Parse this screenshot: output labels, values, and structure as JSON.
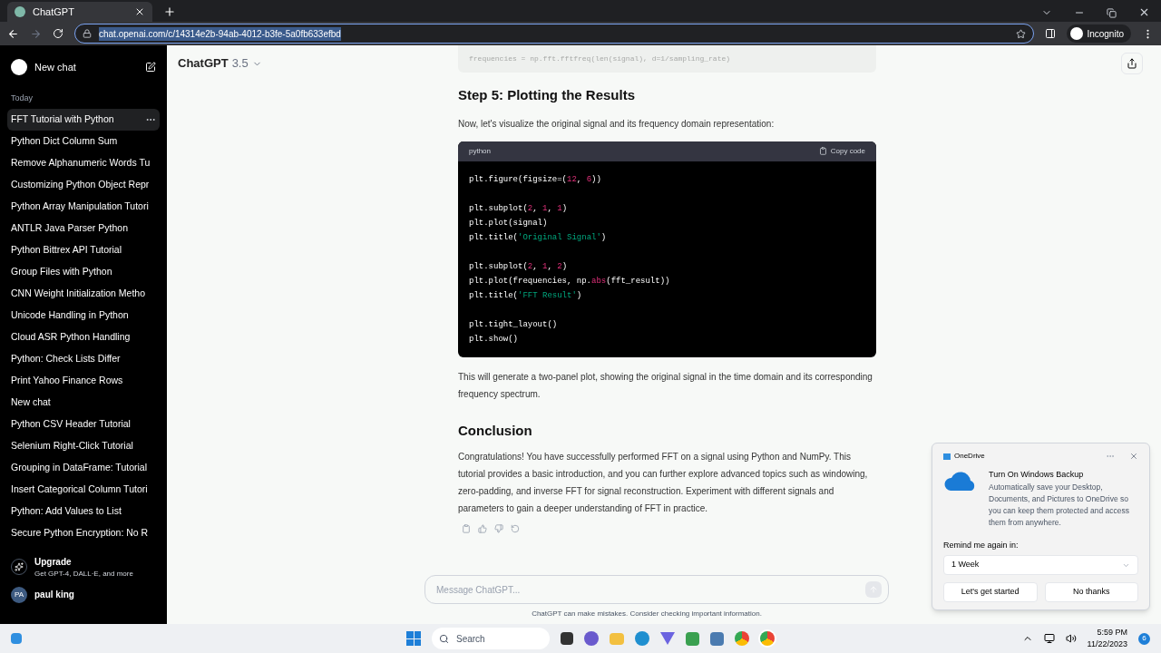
{
  "browser": {
    "tab_title": "ChatGPT",
    "url": "chat.openai.com/c/14314e2b-94ab-4012-b3fe-5a0fb633efbd",
    "profile": "Incognito"
  },
  "sidebar": {
    "new_chat": "New chat",
    "section": "Today",
    "items": [
      {
        "label": "FFT Tutorial with Python",
        "selected": true
      },
      {
        "label": "Python Dict Column Sum",
        "selected": false
      },
      {
        "label": "Remove Alphanumeric Words Tu",
        "selected": false
      },
      {
        "label": "Customizing Python Object Repr",
        "selected": false
      },
      {
        "label": "Python Array Manipulation Tutori",
        "selected": false
      },
      {
        "label": "ANTLR Java Parser Python",
        "selected": false
      },
      {
        "label": "Python Bittrex API Tutorial",
        "selected": false
      },
      {
        "label": "Group Files with Python",
        "selected": false
      },
      {
        "label": "CNN Weight Initialization Metho",
        "selected": false
      },
      {
        "label": "Unicode Handling in Python",
        "selected": false
      },
      {
        "label": "Cloud ASR Python Handling",
        "selected": false
      },
      {
        "label": "Python: Check Lists Differ",
        "selected": false
      },
      {
        "label": "Print Yahoo Finance Rows",
        "selected": false
      },
      {
        "label": "New chat",
        "selected": false
      },
      {
        "label": "Python CSV Header Tutorial",
        "selected": false
      },
      {
        "label": "Selenium Right-Click Tutorial",
        "selected": false
      },
      {
        "label": "Grouping in DataFrame: Tutorial",
        "selected": false
      },
      {
        "label": "Insert Categorical Column Tutori",
        "selected": false
      },
      {
        "label": "Python: Add Values to List",
        "selected": false
      },
      {
        "label": "Secure Python Encryption: No R",
        "selected": false
      }
    ],
    "upgrade": {
      "title": "Upgrade",
      "subtitle": "Get GPT-4, DALL·E, and more"
    },
    "user": {
      "initials": "PA",
      "name": "paul king"
    }
  },
  "header": {
    "model": "ChatGPT",
    "version": "3.5"
  },
  "content": {
    "faded_code": "frequencies = np.fft.fftfreq(len(signal), d=1/sampling_rate)",
    "heading_1": "Step 5: Plotting the Results",
    "intro": "Now, let's visualize the original signal and its frequency domain representation:",
    "code_block": {
      "language": "python",
      "copy_label": "Copy code",
      "lines": [
        {
          "gap_after": true,
          "segments": [
            {
              "t": "plt.figure(figsize=(",
              "kind": "plain"
            },
            {
              "t": "12",
              "kind": "number"
            },
            {
              "t": ", ",
              "kind": "plain"
            },
            {
              "t": "6",
              "kind": "number"
            },
            {
              "t": "))",
              "kind": "plain"
            }
          ]
        },
        {
          "gap_after": false,
          "segments": [
            {
              "t": "plt.subplot(",
              "kind": "plain"
            },
            {
              "t": "2",
              "kind": "number"
            },
            {
              "t": ", ",
              "kind": "plain"
            },
            {
              "t": "1",
              "kind": "number"
            },
            {
              "t": ", ",
              "kind": "plain"
            },
            {
              "t": "1",
              "kind": "number"
            },
            {
              "t": ")",
              "kind": "plain"
            }
          ]
        },
        {
          "gap_after": false,
          "segments": [
            {
              "t": "plt.plot(signal)",
              "kind": "plain"
            }
          ]
        },
        {
          "gap_after": true,
          "segments": [
            {
              "t": "plt.title(",
              "kind": "plain"
            },
            {
              "t": "'Original Signal'",
              "kind": "string"
            },
            {
              "t": ")",
              "kind": "plain"
            }
          ]
        },
        {
          "gap_after": false,
          "segments": [
            {
              "t": "plt.subplot(",
              "kind": "plain"
            },
            {
              "t": "2",
              "kind": "number"
            },
            {
              "t": ", ",
              "kind": "plain"
            },
            {
              "t": "1",
              "kind": "number"
            },
            {
              "t": ", ",
              "kind": "plain"
            },
            {
              "t": "2",
              "kind": "number"
            },
            {
              "t": ")",
              "kind": "plain"
            }
          ]
        },
        {
          "gap_after": false,
          "segments": [
            {
              "t": "plt.plot(frequencies, np.",
              "kind": "plain"
            },
            {
              "t": "abs",
              "kind": "builtin"
            },
            {
              "t": "(fft_result))",
              "kind": "plain"
            }
          ]
        },
        {
          "gap_after": true,
          "segments": [
            {
              "t": "plt.title(",
              "kind": "plain"
            },
            {
              "t": "'FFT Result'",
              "kind": "string"
            },
            {
              "t": ")",
              "kind": "plain"
            }
          ]
        },
        {
          "gap_after": false,
          "segments": [
            {
              "t": "plt.tight_layout()",
              "kind": "plain"
            }
          ]
        },
        {
          "gap_after": false,
          "segments": [
            {
              "t": "plt.show()",
              "kind": "plain"
            }
          ]
        }
      ]
    },
    "paragraph_2": "This will generate a two-panel plot, showing the original signal in the time domain and its corresponding frequency spectrum.",
    "heading_2": "Conclusion",
    "paragraph_3": "Congratulations! You have successfully performed FFT on a signal using Python and NumPy. This tutorial provides a basic introduction, and you can further explore advanced topics such as windowing, zero-padding, and inverse FFT for signal reconstruction. Experiment with different signals and parameters to gain a deeper understanding of FFT in practice."
  },
  "composer": {
    "placeholder": "Message ChatGPT...",
    "disclaimer": "ChatGPT can make mistakes. Consider checking important information."
  },
  "notification": {
    "app": "OneDrive",
    "title": "Turn On Windows Backup",
    "body": "Automatically save your Desktop, Documents, and Pictures to OneDrive so you can keep them protected and access them from anywhere.",
    "remind_label": "Remind me again in:",
    "remind_value": "1 Week",
    "buttons": [
      "Let's get started",
      "No thanks"
    ]
  },
  "taskbar": {
    "search_placeholder": "Search",
    "time": "5:59 PM",
    "date": "11/22/2023",
    "badge": "6"
  }
}
